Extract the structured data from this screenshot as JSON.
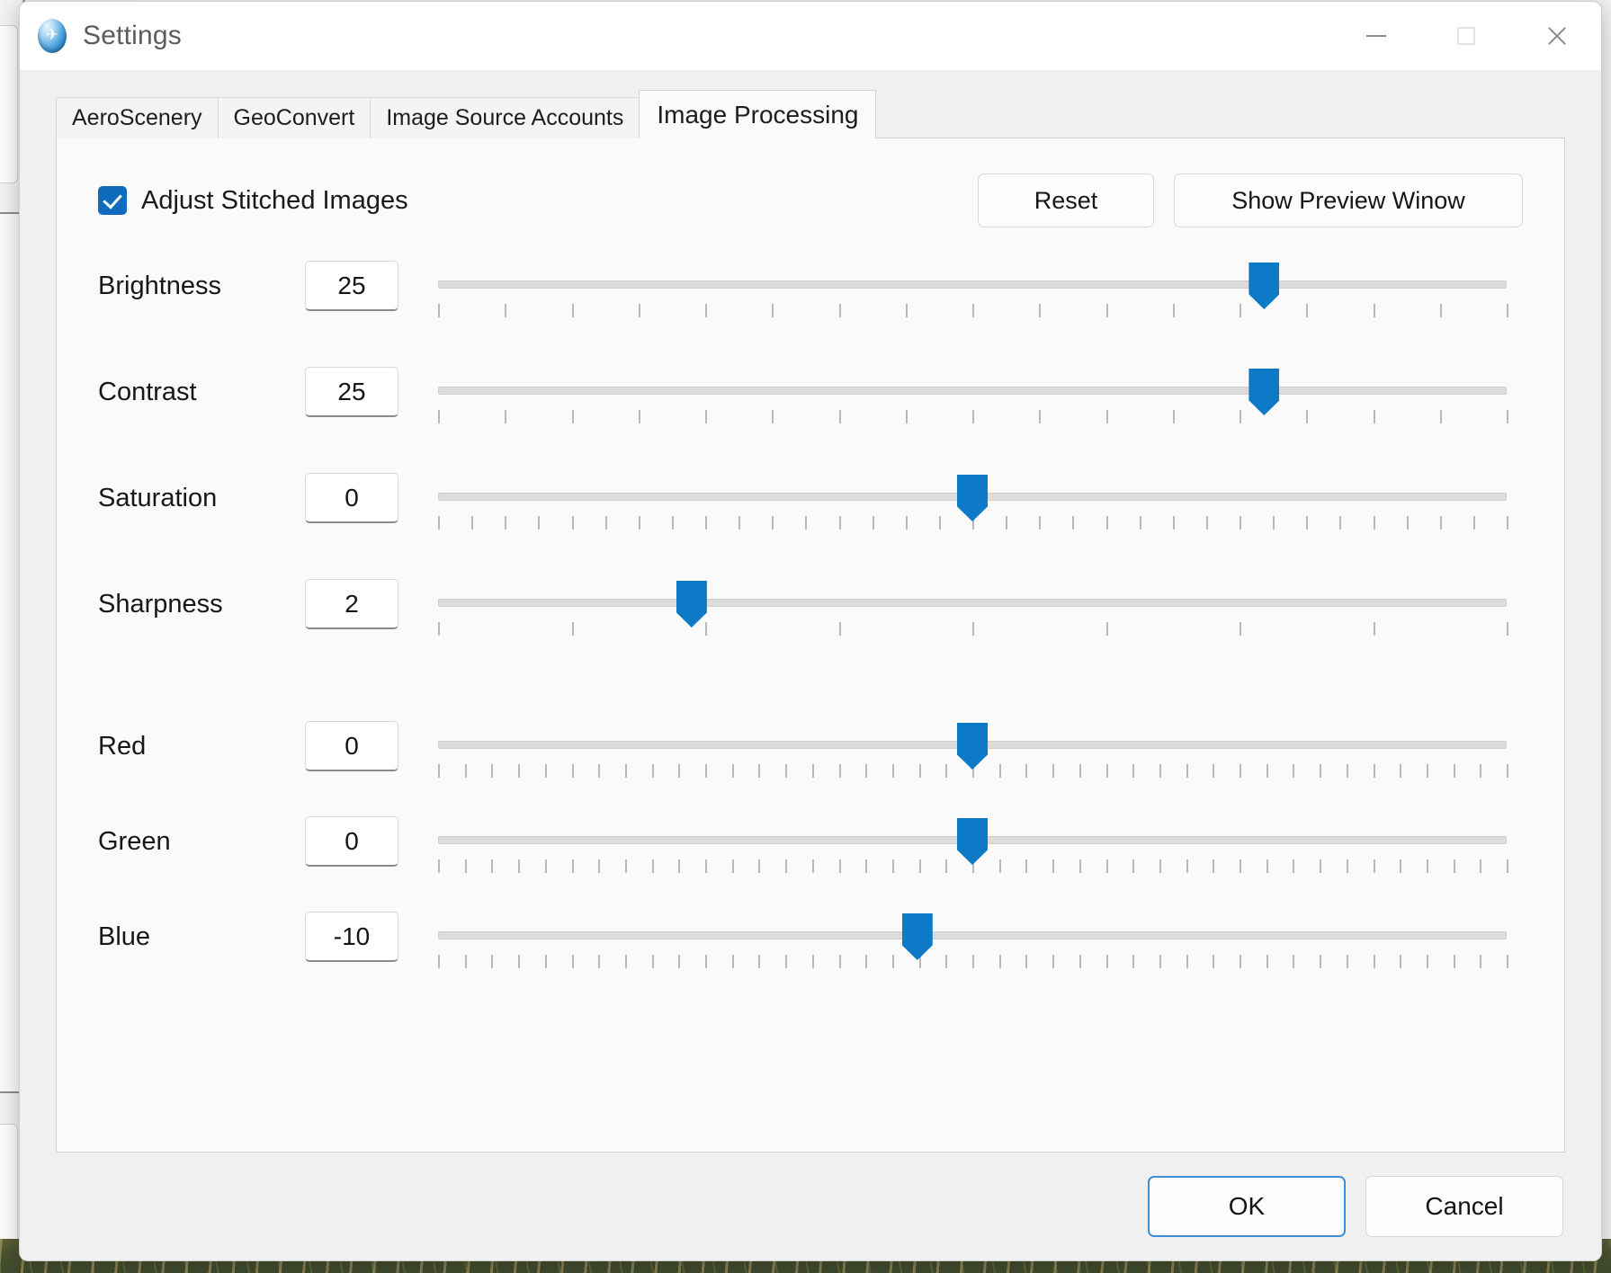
{
  "window": {
    "title": "Settings",
    "icon": "aeroscenery-app-icon",
    "controls": {
      "minimize": "minimize-icon",
      "maximize": "maximize-icon",
      "close": "close-icon"
    }
  },
  "tabs": [
    {
      "label": "AeroScenery",
      "active": false
    },
    {
      "label": "GeoConvert",
      "active": false
    },
    {
      "label": "Image Source Accounts",
      "active": false
    },
    {
      "label": "Image Processing",
      "active": true
    }
  ],
  "toolbar": {
    "checkbox_label": "Adjust Stitched Images",
    "checkbox_checked": true,
    "reset_label": "Reset",
    "show_preview_label": "Show Preview Winow"
  },
  "sliders": [
    {
      "name": "brightness",
      "label": "Brightness",
      "value": "25",
      "min": -100,
      "max": 100,
      "percent": 76.5,
      "ticks": 17
    },
    {
      "name": "contrast",
      "label": "Contrast",
      "value": "25",
      "min": -100,
      "max": 100,
      "percent": 76.5,
      "ticks": 17
    },
    {
      "name": "saturation",
      "label": "Saturation",
      "value": "0",
      "min": -100,
      "max": 100,
      "percent": 50.0,
      "ticks": 33
    },
    {
      "name": "sharpness",
      "label": "Sharpness",
      "value": "2",
      "min": 0,
      "max": 8,
      "percent": 24.5,
      "ticks": 9
    },
    {
      "name": "red",
      "label": "Red",
      "value": "0",
      "min": -100,
      "max": 100,
      "percent": 50.0,
      "ticks": 41
    },
    {
      "name": "green",
      "label": "Green",
      "value": "0",
      "min": -100,
      "max": 100,
      "percent": 50.0,
      "ticks": 41
    },
    {
      "name": "blue",
      "label": "Blue",
      "value": "-10",
      "min": -100,
      "max": 100,
      "percent": 45.0,
      "ticks": 41
    }
  ],
  "footer": {
    "ok_label": "OK",
    "cancel_label": "Cancel"
  },
  "colors": {
    "accent": "#0d7ac8",
    "checkbox": "#0f6cbd",
    "default_button_border": "#3f8fd4",
    "page_bg": "#fafafa",
    "dialog_bg": "#f0f0f0"
  }
}
